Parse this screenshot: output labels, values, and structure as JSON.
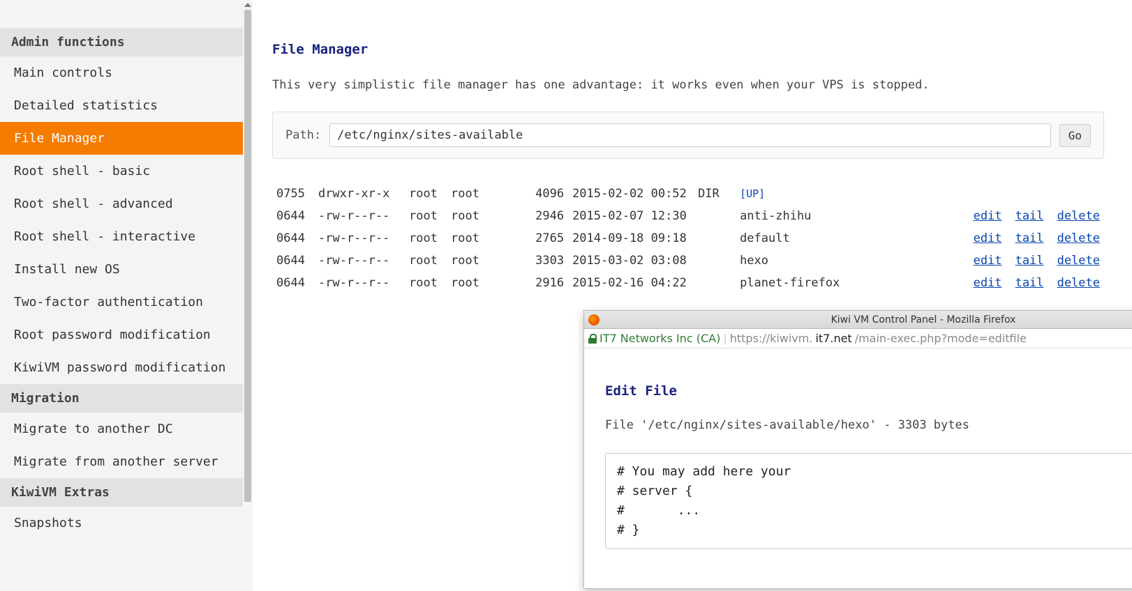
{
  "sidebar": {
    "sections": [
      {
        "title": "Admin functions",
        "items": [
          {
            "label": "Main controls",
            "active": false
          },
          {
            "label": "Detailed statistics",
            "active": false
          },
          {
            "label": "File Manager",
            "active": true
          },
          {
            "label": "Root shell - basic",
            "active": false
          },
          {
            "label": "Root shell - advanced",
            "active": false
          },
          {
            "label": "Root shell - interactive",
            "active": false
          },
          {
            "label": "Install new OS",
            "active": false
          },
          {
            "label": "Two-factor authentication",
            "active": false
          },
          {
            "label": "Root password modification",
            "active": false
          },
          {
            "label": "KiwiVM password modification",
            "active": false
          }
        ]
      },
      {
        "title": "Migration",
        "items": [
          {
            "label": "Migrate to another DC",
            "active": false
          },
          {
            "label": "Migrate from another server",
            "active": false
          }
        ]
      },
      {
        "title": "KiwiVM Extras",
        "items": [
          {
            "label": "Snapshots",
            "active": false
          }
        ]
      }
    ]
  },
  "main": {
    "title": "File Manager",
    "intro": "This very simplistic file manager has one advantage: it works even when your VPS is stopped.",
    "path_label": "Path:",
    "path_value": "/etc/nginx/sites-available",
    "go_label": "Go",
    "up_label": "[UP]",
    "action_labels": {
      "edit": "edit",
      "tail": "tail",
      "delete": "delete"
    },
    "rows": [
      {
        "mode": "0755",
        "perm": "drwxr-xr-x",
        "owner": "root",
        "group": "root",
        "size": "4096",
        "date": "2015-02-02 00:52",
        "type": "DIR",
        "name": "",
        "up": true
      },
      {
        "mode": "0644",
        "perm": "-rw-r--r--",
        "owner": "root",
        "group": "root",
        "size": "2946",
        "date": "2015-02-07 12:30",
        "type": "",
        "name": "anti-zhihu",
        "up": false
      },
      {
        "mode": "0644",
        "perm": "-rw-r--r--",
        "owner": "root",
        "group": "root",
        "size": "2765",
        "date": "2014-09-18 09:18",
        "type": "",
        "name": "default",
        "up": false
      },
      {
        "mode": "0644",
        "perm": "-rw-r--r--",
        "owner": "root",
        "group": "root",
        "size": "3303",
        "date": "2015-03-02 03:08",
        "type": "",
        "name": "hexo",
        "up": false
      },
      {
        "mode": "0644",
        "perm": "-rw-r--r--",
        "owner": "root",
        "group": "root",
        "size": "2916",
        "date": "2015-02-16 04:22",
        "type": "",
        "name": "planet-firefox",
        "up": false
      }
    ]
  },
  "popup": {
    "window_title": "Kiwi VM Control Panel - Mozilla Firefox",
    "cert": "IT7 Networks Inc (CA)",
    "url_prefix": "https://kiwivm.",
    "url_host": "it7.net",
    "url_path": "/main-exec.php?mode=editfile",
    "edit_title": "Edit File",
    "file_meta": "File '/etc/nginx/sites-available/hexo'  -  3303 bytes",
    "editor_text": "# You may add here your\n# server {\n#       ...\n# }"
  }
}
